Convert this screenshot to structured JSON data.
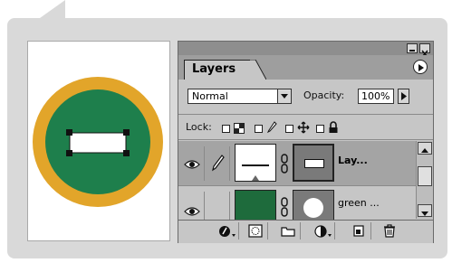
{
  "canvas": {
    "colors": {
      "ring": "#e2a52a",
      "fill": "#1e7f4c",
      "rect": "#ffffff",
      "handles": "#111111"
    }
  },
  "layers_panel": {
    "tab_label": "Layers",
    "blend_mode": "Normal",
    "opacity_label": "Opacity:",
    "opacity_value": "100%",
    "lock_label": "Lock:",
    "layers": [
      {
        "name": "Lay...",
        "selected": true
      },
      {
        "name": "green ...",
        "selected": false
      }
    ],
    "icons": {
      "window": [
        "minimize-icon",
        "close-icon"
      ],
      "menu": "panel-menu-icon",
      "lock": [
        "lock-transparent-icon",
        "lock-image-icon",
        "lock-position-icon",
        "lock-all-icon"
      ],
      "bottom": [
        "layer-style-icon",
        "add-mask-icon",
        "new-set-icon",
        "adjustment-layer-icon",
        "new-layer-icon",
        "trash-icon"
      ]
    }
  }
}
